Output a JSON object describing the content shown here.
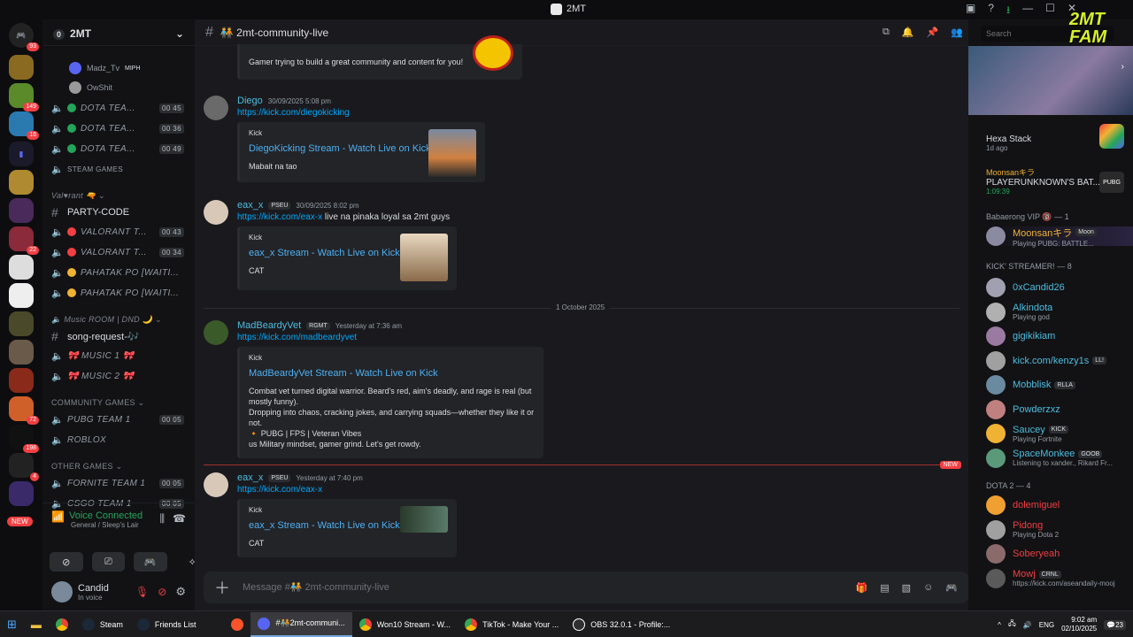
{
  "window": {
    "title": "2MT"
  },
  "server": {
    "name": "2MT",
    "badge": "0"
  },
  "guild_badges": [
    "93",
    "149",
    "16",
    "22",
    "72",
    "198",
    "4"
  ],
  "guild_new": "NEW",
  "channels": {
    "voice_users": [
      "Madz_Tv",
      "OwShit"
    ],
    "madz_tag": "MIPH",
    "items": [
      {
        "name": "DOTA TEA...",
        "c1": "00",
        "c2": "45"
      },
      {
        "name": "DOTA TEA...",
        "c1": "00",
        "c2": "36"
      },
      {
        "name": "DOTA TEA...",
        "c1": "00",
        "c2": "49"
      }
    ],
    "steam_games": "STEAM GAMES",
    "cat_valorant": "Val♥rant 🔫",
    "party_code": "PARTY-CODE",
    "val1": {
      "name": "VALORANT T...",
      "c1": "00",
      "c2": "43"
    },
    "val2": {
      "name": "VALORANT T...",
      "c1": "00",
      "c2": "34"
    },
    "pahatak1": "PAHATAK PO [WAITI...",
    "pahatak2": "PAHATAK PO [WAITI...",
    "cat_music": "Music ROOM | DND 🌙",
    "song_request": "song-request-🎶",
    "music1": "🎀 MUSIC 1 🎀",
    "music2": "🎀 MUSIC 2 🎀",
    "cat_community": "COMMUNITY GAMES",
    "pubg": {
      "name": "PUBG TEAM 1",
      "c1": "00",
      "c2": "05"
    },
    "roblox": "ROBLOX",
    "cat_other": "OTHER GAMES",
    "fortnite": {
      "name": "FORNITE TEAM 1",
      "c1": "00",
      "c2": "05"
    },
    "csgo": {
      "name": "CSGO TEAM 1",
      "c1": "00",
      "c2": "05"
    }
  },
  "voice": {
    "status": "Voice Connected",
    "location": "General / Sleep's Lair"
  },
  "user": {
    "name": "Candid",
    "status": "In voice"
  },
  "header": {
    "channel": "🧑‍🤝‍🧑 2mt-community-live"
  },
  "messages": {
    "top_embed_desc": "Gamer trying to build a great community and content for you!",
    "m1": {
      "author": "Diego",
      "time": "30/09/2025 5:08 pm",
      "link": "https://kick.com/diegokicking",
      "provider": "Kick",
      "title": "DiegoKicking Stream - Watch Live on Kick",
      "desc": "Mabait na tao"
    },
    "m2": {
      "author": "eax_x",
      "tag": "PSEU",
      "time": "30/09/2025 8:02 pm",
      "link": "https://kick.com/eax-x",
      "text": " live na pinaka loyal sa 2mt guys",
      "provider": "Kick",
      "title": "eax_x Stream - Watch Live on Kick",
      "desc": "CAT"
    },
    "divider": "1 October 2025",
    "m3": {
      "author": "MadBeardyVet",
      "tag": "RGMT",
      "time": "Yesterday at 7:36 am",
      "link": "https://kick.com/madbeardyvet",
      "provider": "Kick",
      "title": "MadBeardyVet Stream - Watch Live on Kick",
      "d1": "Combat vet turned digital warrior. Beard's red, aim's deadly, and rage is real (but",
      "d2": "mostly funny).",
      "d3": "Dropping into chaos, cracking jokes, and carrying squads—whether they like it or",
      "d4": "not.",
      "d5": "🔸 PUBG | FPS | Veteran Vibes",
      "d6": "us Military mindset, gamer grind. Let's get rowdy."
    },
    "new_label": "NEW",
    "m4": {
      "author": "eax_x",
      "tag": "PSEU",
      "time": "Yesterday at 7:40 pm",
      "link": "https://kick.com/eax-x",
      "provider": "Kick",
      "title": "eax_x Stream - Watch Live on Kick",
      "desc": "CAT"
    }
  },
  "composer": {
    "placeholder": "Message #🧑‍🤝‍🧑 2mt-community-live"
  },
  "members": {
    "search_placeholder": "Search",
    "logo": "2MT FAM",
    "act1": {
      "name": "Hexa Stack",
      "time": "1d ago"
    },
    "act2": {
      "name": "Moonsanキラ",
      "game": "PLAYERUNKNOWN'S BAT...",
      "time": "1:09:39"
    },
    "grp1": "Babaerong VIP 🔞 — 1",
    "vip": {
      "name": "Moonsanキラ",
      "badge": "Moon",
      "status": "Playing PUBG: BATTLE..."
    },
    "grp2": "KICK' STREAMER! — 8",
    "kick": [
      {
        "name": "0xCandid26",
        "status": "",
        "badge": ""
      },
      {
        "name": "Alkindota",
        "status": "Playing god",
        "badge": ""
      },
      {
        "name": "gigikikiam",
        "status": "",
        "badge": ""
      },
      {
        "name": "kick.com/kenzy1s",
        "status": "",
        "badge": "LL!"
      },
      {
        "name": "Mobblisk",
        "status": "",
        "badge": "RLLA"
      },
      {
        "name": "Powderzxz",
        "status": "",
        "badge": ""
      },
      {
        "name": "Saucey",
        "status": "Playing Fortnite",
        "badge": "KICK"
      },
      {
        "name": "SpaceMonkee",
        "status": "Listening to xander., Rikard Fr...",
        "badge": "GOOB"
      }
    ],
    "grp3": "DOTA 2 — 4",
    "dota": [
      {
        "name": "dolemiguel",
        "status": "",
        "badge": ""
      },
      {
        "name": "Pidong",
        "status": "Playing Dota 2",
        "badge": ""
      },
      {
        "name": "Soberyeah",
        "status": "",
        "badge": ""
      },
      {
        "name": "Mowj",
        "status": "https://kick.com/aseandaily-mooj",
        "badge": "CRNL"
      }
    ]
  },
  "taskbar": {
    "tasks": [
      "Steam",
      "Friends List",
      "#🧑‍🤝‍🧑2mt-communi...",
      "Won10 Stream - W...",
      "TikTok - Make Your ...",
      "OBS 32.0.1 - Profile:..."
    ],
    "lang": "ENG",
    "time": "9:02 am",
    "date": "02/10/2025",
    "notif": "23"
  },
  "colors": {
    "accent": "#5865f2",
    "online": "#23a55a",
    "dnd": "#f23f43",
    "idle": "#f0b232",
    "link": "#00a8fc"
  }
}
